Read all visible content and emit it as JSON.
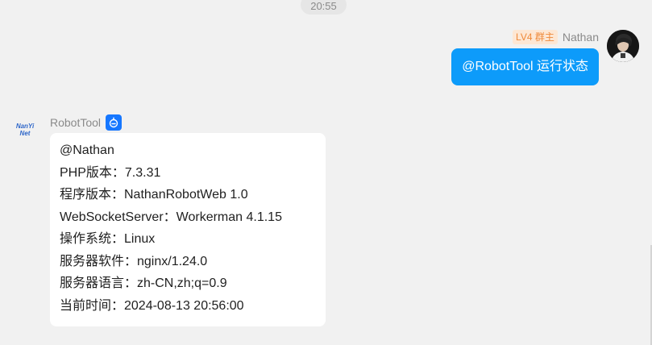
{
  "chat": {
    "timestamp": "20:55",
    "outgoing": {
      "level_badge": "LV4 群主",
      "sender": "Nathan",
      "message": "@RobotTool 运行状态"
    },
    "incoming": {
      "avatar_text_line1": "NanYi",
      "avatar_text_line2": "Net",
      "sender": "RobotTool",
      "badge_icon": "robot-icon",
      "lines": [
        "@Nathan",
        "PHP版本：7.3.31",
        "程序版本：NathanRobotWeb 1.0",
        "WebSocketServer：Workerman 4.1.15",
        "操作系统：Linux",
        "服务器软件：nginx/1.24.0",
        "服务器语言：zh-CN,zh;q=0.9",
        "当前时间：2024-08-13 20:56:00"
      ]
    }
  },
  "colors": {
    "background": "#f1f1f1",
    "outgoing_bubble": "#0d9bfa",
    "incoming_bubble": "#ffffff",
    "bot_badge": "#1677ff",
    "level_badge_bg": "#fde7d4",
    "level_badge_text": "#ef8a3a"
  }
}
